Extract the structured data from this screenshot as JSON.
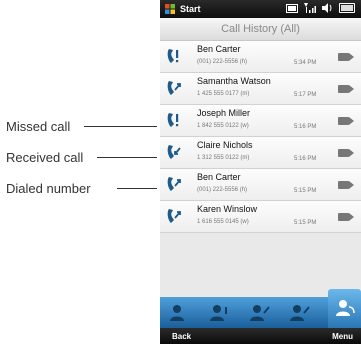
{
  "callouts": {
    "missed": "Missed call",
    "received": "Received call",
    "dialed": "Dialed number"
  },
  "status": {
    "start": "Start"
  },
  "title": "Call History (All)",
  "calls": [
    {
      "type": "missed",
      "name": "Ben Carter",
      "number": "(001) 222-5556 (h)",
      "time": "5:34 PM"
    },
    {
      "type": "dialed",
      "name": "Samantha Watson",
      "number": "1 425 555 0177 (m)",
      "time": "5:17 PM"
    },
    {
      "type": "missed",
      "name": "Joseph Miller",
      "number": "1 842 555 0122 (w)",
      "time": "5:16 PM"
    },
    {
      "type": "received",
      "name": "Claire Nichols",
      "number": "1 312 555 0122 (m)",
      "time": "5:16 PM"
    },
    {
      "type": "dialed",
      "name": "Ben Carter",
      "number": "(001) 222-5556 (h)",
      "time": "5:15 PM"
    },
    {
      "type": "dialed",
      "name": "Karen Winslow",
      "number": "1 616 555 0145 (w)",
      "time": "5:15 PM"
    }
  ],
  "softkeys": {
    "left": "Back",
    "right": "Menu"
  },
  "colors": {
    "accent": "#2a77b5",
    "call_icon": "#1e5b8c"
  }
}
